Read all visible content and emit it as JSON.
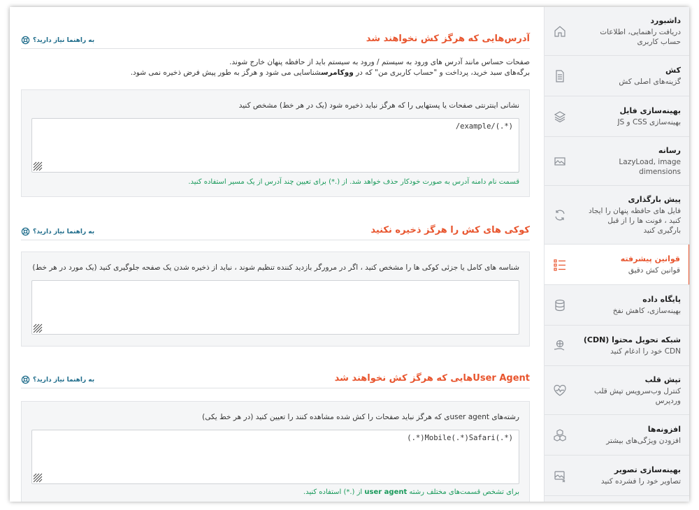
{
  "sidebar": {
    "items": [
      {
        "title": "داشبورد",
        "sub": "دریافت راهنمایی، اطلاعات حساب کاربری",
        "icon": "home-icon"
      },
      {
        "title": "کش",
        "sub": "گزینه‌های اصلی کش",
        "icon": "document-icon"
      },
      {
        "title": "بهینه‌سازی فایل",
        "sub": "بهینه‌سازی CSS و JS",
        "icon": "layers-icon"
      },
      {
        "title": "رسانه",
        "sub": "LazyLoad, image dimensions",
        "icon": "image-icon"
      },
      {
        "title": "پیش بارگذاری",
        "sub": "فایل های حافظه پنهان را ایجاد کنید ، فونت ها را از قبل بارگیری کنید",
        "icon": "refresh-icon"
      },
      {
        "title": "قوانین پیشرفته",
        "sub": "قوانین کش دقیق",
        "icon": "list-icon"
      },
      {
        "title": "پایگاه داده",
        "sub": "بهینه‌سازی، کاهش نفخ",
        "icon": "database-icon"
      },
      {
        "title": "شبکه تحویل محتوا (CDN)",
        "sub": "CDN خود را ادغام کنید",
        "icon": "globe-hand-icon"
      },
      {
        "title": "تپش قلب",
        "sub": "کنترل وب‌سرویس تپش قلب وردپرس",
        "icon": "heartbeat-icon"
      },
      {
        "title": "افزونه‌ها",
        "sub": "افزودن ویژگی‌های بیشتر",
        "icon": "cubes-icon"
      },
      {
        "title": "بهینه‌سازی تصویر",
        "sub": "تصاویر خود را فشرده کنید",
        "icon": "image-compress-icon"
      }
    ],
    "active_index": 5
  },
  "help_label": "به راهنما نیاز دارید؟",
  "sections": {
    "urls": {
      "title": "آدرس‌هایی که هرگز کش نخواهند شد",
      "desc_line1": "صفحات حساس مانند آدرس های ورود به سیستم / ورود به سیستم باید از حافظه پنهان خارج شوند.",
      "desc_line2_a": "برگه‌های سبد خرید، پرداخت و \"حساب کاربری من\" که در ",
      "desc_line2_b": "ووکامرس",
      "desc_line2_c": "شناسایی می شود و هرگز به طور پیش فرض ذخیره نمی شود.",
      "field_label": "نشانی اینترنتی صفحات یا پستهایی را که هرگز نباید ذخیره شود (یک در هر خط) مشخص کنید",
      "field_value": "/example/(.*)",
      "note": "قسمت نام دامنه آدرس به صورت خودکار حذف خواهد شد. از (.*) برای تعیین چند آدرس از یک مسیر استفاده کنید."
    },
    "cookies": {
      "title": "کوکی های کش را هرگز ذخیره نکنید",
      "field_label": "شناسه های کامل یا جزئی کوکی ها را مشخص کنید ، اگر در مرورگر بازدید کننده تنظیم شوند ، نباید از ذخیره شدن یک صفحه جلوگیری کنید (یک مورد در هر خط)",
      "field_value": ""
    },
    "agents": {
      "title": "User Agentهایی که هرگز کش نخواهند شد",
      "field_label": "رشته‌های user agentی که هرگز نباید صفحات را کش شده مشاهده کنند را تعیین کنید (در هر خط یکی)",
      "field_value": "(.*)Mobile(.*)Safari(.*)",
      "note_a": "برای تشخص قسمت‌های مختلف رشته ",
      "note_b": "user agent",
      "note_c": " از (.*) استفاده کنید."
    }
  },
  "colors": {
    "accent": "#e8552e",
    "help": "#1d6b8a",
    "note": "#1a9a5b"
  }
}
